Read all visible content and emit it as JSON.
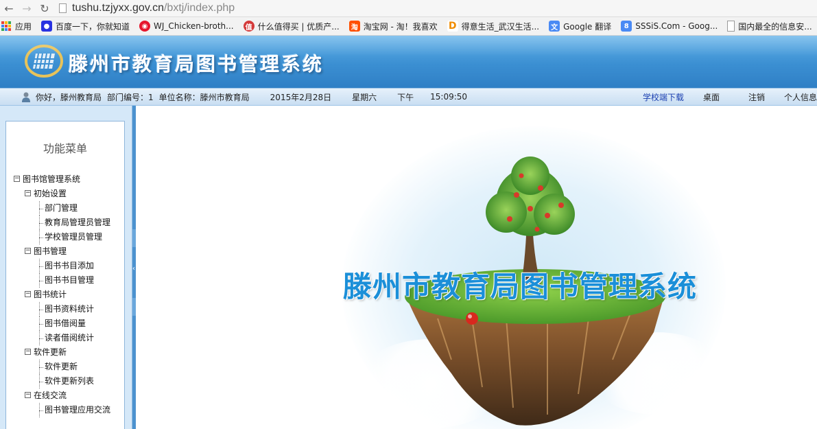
{
  "browser": {
    "url_host": "tushu.tzjyxx.gov.cn",
    "url_path": "/bxtj/index.php",
    "bookmarks": [
      {
        "label": "应用",
        "icon": "apps-grid-icon"
      },
      {
        "label": "百度一下，你就知道",
        "icon": "baidu-paw-icon",
        "color": "#2932e1"
      },
      {
        "label": "WJ_Chicken-broth...",
        "icon": "weibo-icon",
        "color": "#e6162d"
      },
      {
        "label": "什么值得买 | 优质产...",
        "icon": "smzdm-icon",
        "color": "#d43a3a"
      },
      {
        "label": "淘宝网 - 淘！我喜欢",
        "icon": "taobao-icon",
        "color": "#ff5000"
      },
      {
        "label": "得意生活_武汉生活...",
        "icon": "deyi-icon",
        "color": "#f08c00"
      },
      {
        "label": "Google 翻译",
        "icon": "google-translate-icon",
        "color": "#4a8af4"
      },
      {
        "label": "SSSiS.Com - Goog...",
        "icon": "google-plus-icon",
        "color": "#4a8af4"
      },
      {
        "label": "国内最全的信息安...",
        "icon": "page-icon",
        "color": "#ffffff"
      }
    ]
  },
  "header": {
    "title": "滕州市教育局图书管理系统"
  },
  "infobar": {
    "greeting": "你好，滕州教育局",
    "dept_no": "部门编号：1",
    "unit_name": "单位名称：滕州市教育局",
    "date": "2015年2月28日",
    "weekday": "星期六",
    "ampm": "下午",
    "time": "15:09:50",
    "links": {
      "download": "学校端下载",
      "desktop": "桌面",
      "logout": "注销",
      "profile": "个人信息"
    }
  },
  "sidebar": {
    "title": "功能菜单",
    "root": "图书馆管理系统",
    "groups": [
      {
        "label": "初始设置",
        "items": [
          "部门管理",
          "教育局管理员管理",
          "学校管理员管理"
        ]
      },
      {
        "label": "图书管理",
        "items": [
          "图书书目添加",
          "图书书目管理"
        ]
      },
      {
        "label": "图书统计",
        "items": [
          "图书资料统计",
          "图书借阅量",
          "读者借阅统计"
        ]
      },
      {
        "label": "软件更新",
        "items": [
          "软件更新",
          "软件更新列表"
        ]
      },
      {
        "label": "在线交流",
        "items": [
          "图书管理应用交流"
        ]
      }
    ]
  },
  "main": {
    "title": "滕州市教育局图书管理系统"
  },
  "colors": {
    "banner": "#3b8fd2",
    "accent_blue": "#1b8fd8",
    "link_blue": "#1a3fb0"
  }
}
